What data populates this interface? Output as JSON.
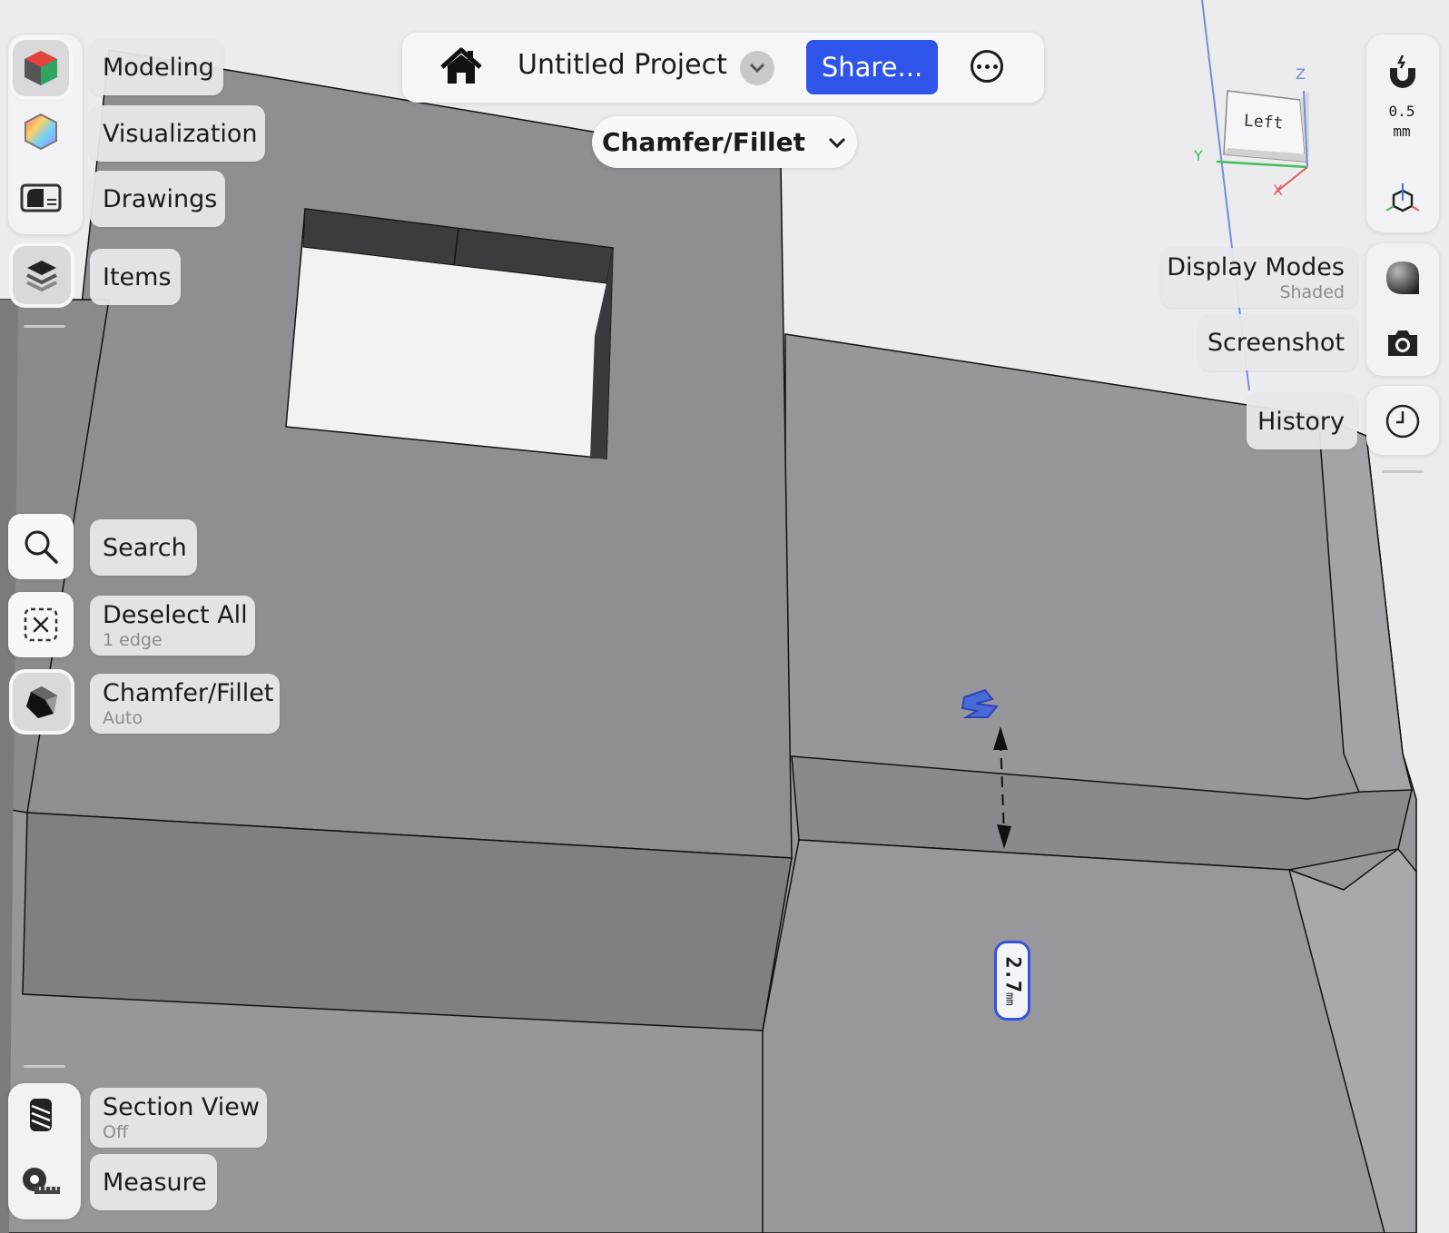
{
  "header": {
    "project_title": "Untitled Project",
    "share_label": "Share..."
  },
  "mode_selector": {
    "label": "Chamfer/Fillet"
  },
  "left_workspaces": [
    {
      "label": "Modeling"
    },
    {
      "label": "Visualization"
    },
    {
      "label": "Drawings"
    }
  ],
  "items": {
    "label": "Items"
  },
  "left_tools": {
    "search": {
      "label": "Search"
    },
    "deselect": {
      "label": "Deselect All",
      "sub": "1 edge"
    },
    "chamfer": {
      "label": "Chamfer/Fillet",
      "sub": "Auto"
    }
  },
  "bottom_tools": {
    "section": {
      "label": "Section View",
      "sub": "Off"
    },
    "measure": {
      "label": "Measure"
    }
  },
  "right_tools": {
    "snap_value": "0.5",
    "snap_unit": "mm",
    "display_modes": {
      "label": "Display Modes",
      "sub": "Shaded"
    },
    "screenshot": {
      "label": "Screenshot"
    },
    "history": {
      "label": "History"
    }
  },
  "view_cube": {
    "face": "Left",
    "axis_x": "X",
    "axis_y": "Y",
    "axis_z": "Z"
  },
  "dimension": {
    "value": "2.7",
    "unit": "mm"
  },
  "icons": [
    "home-icon",
    "chevron-down-icon",
    "more-icon",
    "modeling-cube-icon",
    "color-wheel-icon",
    "drawing-icon",
    "layers-icon",
    "search-icon",
    "deselect-icon",
    "chamfer-icon",
    "section-view-icon",
    "tape-measure-icon",
    "magnet-icon",
    "axes-icon",
    "shaded-sphere-icon",
    "camera-icon",
    "clock-icon"
  ],
  "colors": {
    "accent": "#2F54E9",
    "model_face": "#8E8E93",
    "background": "#ECECEE"
  }
}
